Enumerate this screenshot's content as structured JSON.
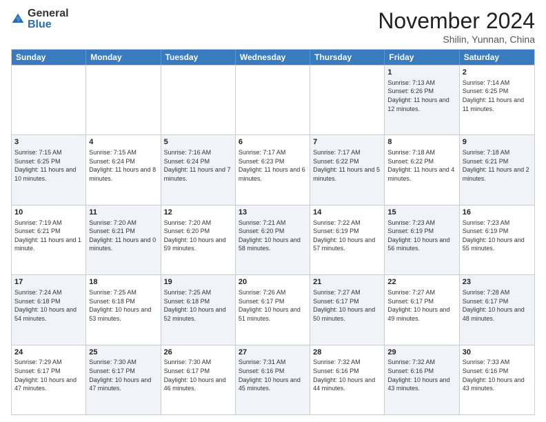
{
  "logo": {
    "general": "General",
    "blue": "Blue"
  },
  "header": {
    "month": "November 2024",
    "location": "Shilin, Yunnan, China"
  },
  "weekdays": [
    "Sunday",
    "Monday",
    "Tuesday",
    "Wednesday",
    "Thursday",
    "Friday",
    "Saturday"
  ],
  "rows": [
    [
      {
        "day": "",
        "info": "",
        "shaded": false
      },
      {
        "day": "",
        "info": "",
        "shaded": false
      },
      {
        "day": "",
        "info": "",
        "shaded": false
      },
      {
        "day": "",
        "info": "",
        "shaded": false
      },
      {
        "day": "",
        "info": "",
        "shaded": false
      },
      {
        "day": "1",
        "info": "Sunrise: 7:13 AM\nSunset: 6:26 PM\nDaylight: 11 hours and 12 minutes.",
        "shaded": true
      },
      {
        "day": "2",
        "info": "Sunrise: 7:14 AM\nSunset: 6:25 PM\nDaylight: 11 hours and 11 minutes.",
        "shaded": false
      }
    ],
    [
      {
        "day": "3",
        "info": "Sunrise: 7:15 AM\nSunset: 6:25 PM\nDaylight: 11 hours and 10 minutes.",
        "shaded": true
      },
      {
        "day": "4",
        "info": "Sunrise: 7:15 AM\nSunset: 6:24 PM\nDaylight: 11 hours and 8 minutes.",
        "shaded": false
      },
      {
        "day": "5",
        "info": "Sunrise: 7:16 AM\nSunset: 6:24 PM\nDaylight: 11 hours and 7 minutes.",
        "shaded": true
      },
      {
        "day": "6",
        "info": "Sunrise: 7:17 AM\nSunset: 6:23 PM\nDaylight: 11 hours and 6 minutes.",
        "shaded": false
      },
      {
        "day": "7",
        "info": "Sunrise: 7:17 AM\nSunset: 6:22 PM\nDaylight: 11 hours and 5 minutes.",
        "shaded": true
      },
      {
        "day": "8",
        "info": "Sunrise: 7:18 AM\nSunset: 6:22 PM\nDaylight: 11 hours and 4 minutes.",
        "shaded": false
      },
      {
        "day": "9",
        "info": "Sunrise: 7:18 AM\nSunset: 6:21 PM\nDaylight: 11 hours and 2 minutes.",
        "shaded": true
      }
    ],
    [
      {
        "day": "10",
        "info": "Sunrise: 7:19 AM\nSunset: 6:21 PM\nDaylight: 11 hours and 1 minute.",
        "shaded": false
      },
      {
        "day": "11",
        "info": "Sunrise: 7:20 AM\nSunset: 6:21 PM\nDaylight: 11 hours and 0 minutes.",
        "shaded": true
      },
      {
        "day": "12",
        "info": "Sunrise: 7:20 AM\nSunset: 6:20 PM\nDaylight: 10 hours and 59 minutes.",
        "shaded": false
      },
      {
        "day": "13",
        "info": "Sunrise: 7:21 AM\nSunset: 6:20 PM\nDaylight: 10 hours and 58 minutes.",
        "shaded": true
      },
      {
        "day": "14",
        "info": "Sunrise: 7:22 AM\nSunset: 6:19 PM\nDaylight: 10 hours and 57 minutes.",
        "shaded": false
      },
      {
        "day": "15",
        "info": "Sunrise: 7:23 AM\nSunset: 6:19 PM\nDaylight: 10 hours and 56 minutes.",
        "shaded": true
      },
      {
        "day": "16",
        "info": "Sunrise: 7:23 AM\nSunset: 6:19 PM\nDaylight: 10 hours and 55 minutes.",
        "shaded": false
      }
    ],
    [
      {
        "day": "17",
        "info": "Sunrise: 7:24 AM\nSunset: 6:18 PM\nDaylight: 10 hours and 54 minutes.",
        "shaded": true
      },
      {
        "day": "18",
        "info": "Sunrise: 7:25 AM\nSunset: 6:18 PM\nDaylight: 10 hours and 53 minutes.",
        "shaded": false
      },
      {
        "day": "19",
        "info": "Sunrise: 7:25 AM\nSunset: 6:18 PM\nDaylight: 10 hours and 52 minutes.",
        "shaded": true
      },
      {
        "day": "20",
        "info": "Sunrise: 7:26 AM\nSunset: 6:17 PM\nDaylight: 10 hours and 51 minutes.",
        "shaded": false
      },
      {
        "day": "21",
        "info": "Sunrise: 7:27 AM\nSunset: 6:17 PM\nDaylight: 10 hours and 50 minutes.",
        "shaded": true
      },
      {
        "day": "22",
        "info": "Sunrise: 7:27 AM\nSunset: 6:17 PM\nDaylight: 10 hours and 49 minutes.",
        "shaded": false
      },
      {
        "day": "23",
        "info": "Sunrise: 7:28 AM\nSunset: 6:17 PM\nDaylight: 10 hours and 48 minutes.",
        "shaded": true
      }
    ],
    [
      {
        "day": "24",
        "info": "Sunrise: 7:29 AM\nSunset: 6:17 PM\nDaylight: 10 hours and 47 minutes.",
        "shaded": false
      },
      {
        "day": "25",
        "info": "Sunrise: 7:30 AM\nSunset: 6:17 PM\nDaylight: 10 hours and 47 minutes.",
        "shaded": true
      },
      {
        "day": "26",
        "info": "Sunrise: 7:30 AM\nSunset: 6:17 PM\nDaylight: 10 hours and 46 minutes.",
        "shaded": false
      },
      {
        "day": "27",
        "info": "Sunrise: 7:31 AM\nSunset: 6:16 PM\nDaylight: 10 hours and 45 minutes.",
        "shaded": true
      },
      {
        "day": "28",
        "info": "Sunrise: 7:32 AM\nSunset: 6:16 PM\nDaylight: 10 hours and 44 minutes.",
        "shaded": false
      },
      {
        "day": "29",
        "info": "Sunrise: 7:32 AM\nSunset: 6:16 PM\nDaylight: 10 hours and 43 minutes.",
        "shaded": true
      },
      {
        "day": "30",
        "info": "Sunrise: 7:33 AM\nSunset: 6:16 PM\nDaylight: 10 hours and 43 minutes.",
        "shaded": false
      }
    ]
  ]
}
